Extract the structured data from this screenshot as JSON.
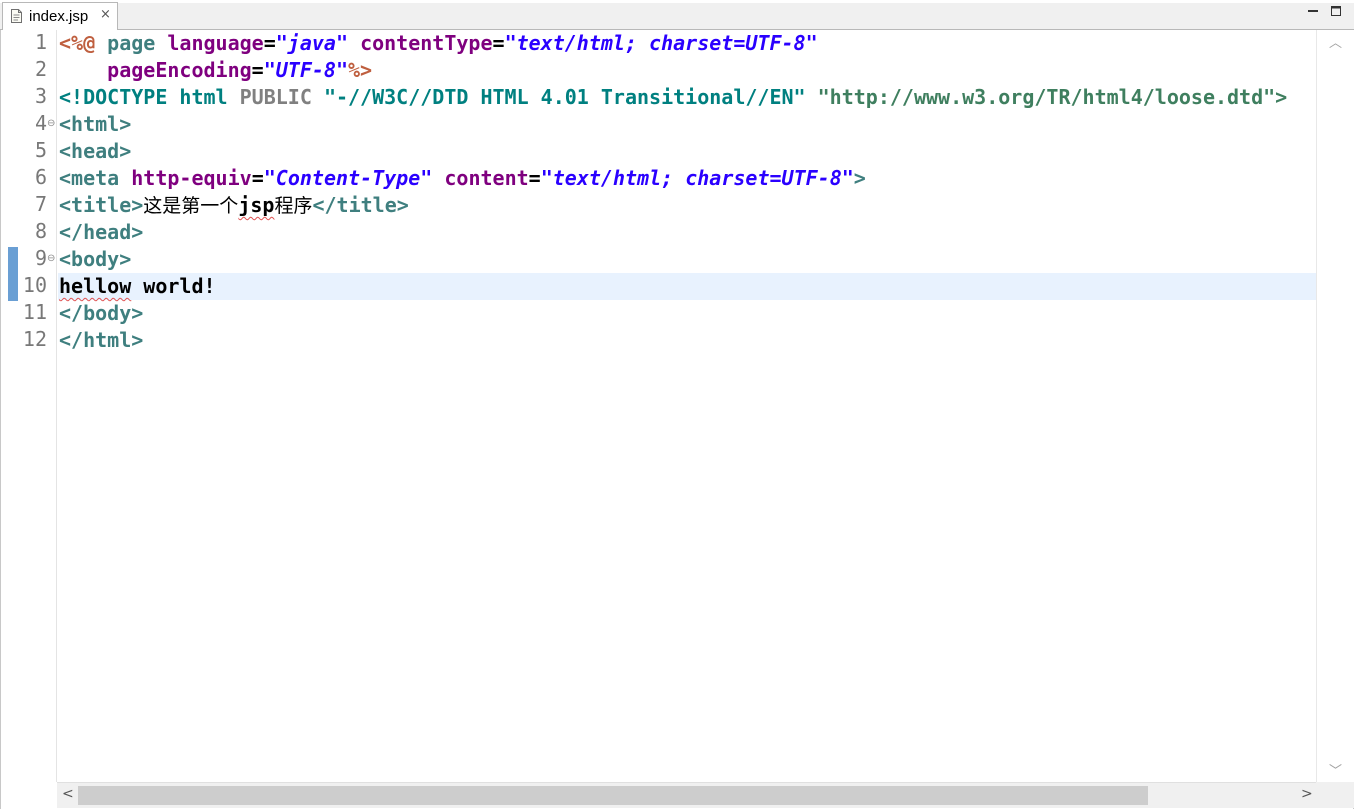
{
  "tab": {
    "title": "index.jsp",
    "close_glyph": "×",
    "icon": "jsp-file-icon"
  },
  "window_buttons": [
    "minimize-icon",
    "maximize-icon"
  ],
  "line_numbers": [
    "1",
    "2",
    "3",
    "4",
    "5",
    "6",
    "7",
    "8",
    "9",
    "10",
    "11",
    "12"
  ],
  "fold_markers": {
    "4": "⊖",
    "9": "⊖"
  },
  "current_line": "10",
  "code": {
    "l1": {
      "open": "<%@",
      "directive": "page",
      "a1": "language",
      "eq1": "=",
      "v1": "\"java\"",
      "a2": "contentType",
      "eq2": "=",
      "v2": "\"text/html; charset=UTF-8\""
    },
    "l2": {
      "indent": "    ",
      "a1": "pageEncoding",
      "eq1": "=",
      "v1": "\"UTF-8\"",
      "close": "%>"
    },
    "l3": {
      "open": "<!DOCTYPE",
      "root": "html",
      "pub": "PUBLIC",
      "fpi": "\"-//W3C//DTD HTML 4.01 Transitional//EN\"",
      "uri": "\"http://www.w3.org/TR/html4/loose.dtd\">"
    },
    "l4": {
      "tag": "<html>"
    },
    "l5": {
      "tag": "<head>"
    },
    "l6": {
      "open": "<meta",
      "a1": "http-equiv",
      "eq1": "=",
      "v1": "\"Content-Type\"",
      "a2": "content",
      "eq2": "=",
      "v2": "\"text/html; charset=UTF-8\"",
      "close": ">"
    },
    "l7": {
      "open": "<title>",
      "text_a": "这是第一个",
      "text_b": "jsp",
      "text_c": "程序",
      "close": "</title>"
    },
    "l8": {
      "tag": "</head>"
    },
    "l9": {
      "tag": "<body>"
    },
    "l10": {
      "word1": "hellow",
      "rest": " world!"
    },
    "l11": {
      "tag": "</body>"
    },
    "l12": {
      "tag": "</html>"
    }
  },
  "scrollbars": {
    "up": "︿",
    "down": "﹀",
    "left": "<",
    "right": ">"
  }
}
